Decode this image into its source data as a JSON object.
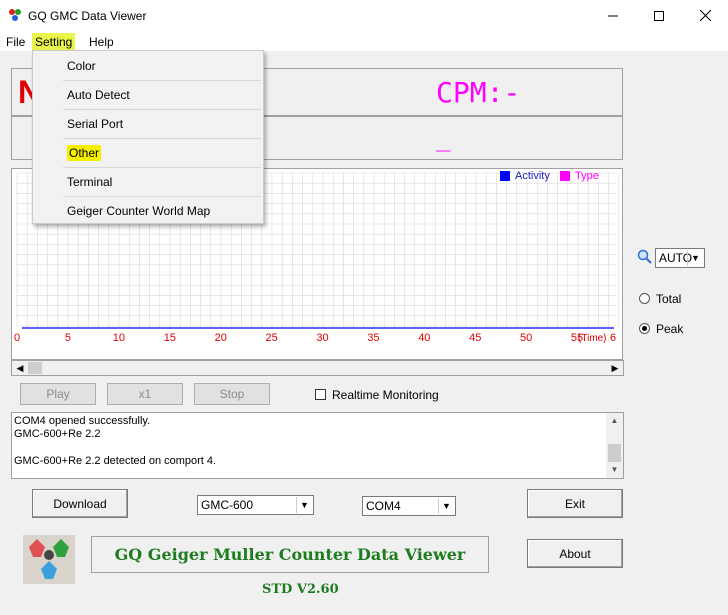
{
  "window": {
    "title": "GQ GMC Data Viewer",
    "minimize": "—",
    "maximize": "☐",
    "close": "✕"
  },
  "menu": {
    "file": "File",
    "setting": "Setting",
    "help": "Help"
  },
  "setting_menu": {
    "items": [
      "Color",
      "Auto Detect",
      "Serial Port",
      "Other",
      "Terminal",
      "Geiger Counter World Map"
    ],
    "highlighted": "Other"
  },
  "readout": {
    "cpm_label": "CPM:-",
    "cpm_value": "_",
    "left_value": "N"
  },
  "chart_data": {
    "type": "line",
    "x_ticks": [
      "0",
      "5",
      "10",
      "15",
      "20",
      "25",
      "30",
      "35",
      "40",
      "45",
      "50",
      "55"
    ],
    "x_unit_label": "(Time)",
    "x_end_label": "6",
    "series": [
      {
        "name": "Activity",
        "color": "#0000ff",
        "values": []
      },
      {
        "name": "Type",
        "color": "#ff00ff",
        "values": []
      }
    ],
    "grid": true,
    "legend": "top-right"
  },
  "scale": {
    "value": "AUTO"
  },
  "mode": {
    "total": "Total",
    "peak": "Peak",
    "selected": "Peak"
  },
  "controls": {
    "play": "Play",
    "speed": "x1",
    "stop": "Stop",
    "realtime": "Realtime Monitoring"
  },
  "log": {
    "lines": [
      "COM4 opened successfully.",
      "GMC-600+Re 2.2",
      "",
      "GMC-600+Re 2.2 detected on comport 4."
    ]
  },
  "bottom": {
    "download": "Download",
    "model": "GMC-600",
    "port": "COM4",
    "exit": "Exit",
    "about": "About",
    "banner": "GQ Geiger Muller Counter Data Viewer",
    "version": "STD V2.60"
  },
  "colors": {
    "accent_green": "#1e7b1e",
    "cpm_magenta": "#ff00ff",
    "axis_red": "#e00000",
    "highlight": "#f4f000"
  }
}
